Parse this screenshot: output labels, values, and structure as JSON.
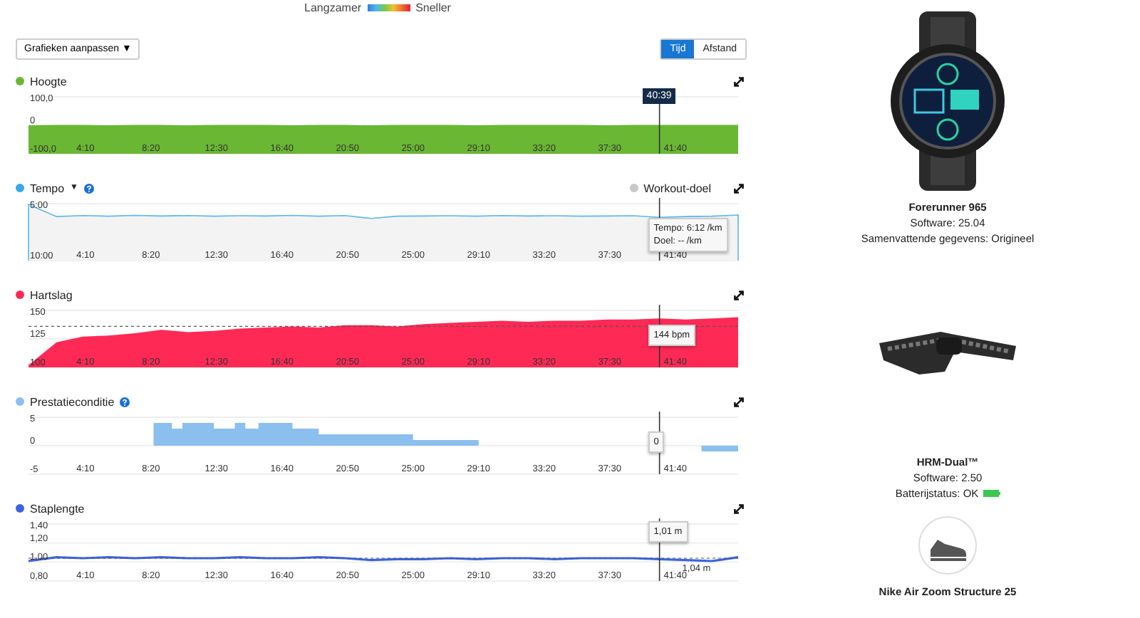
{
  "speed_legend": {
    "slow_label": "Langzamer",
    "fast_label": "Sneller"
  },
  "customize_button": {
    "label": "Grafieken aanpassen",
    "caret": "▼"
  },
  "axis_toggle": [
    {
      "label": "Tijd",
      "selected": true
    },
    {
      "label": "Afstand",
      "selected": false
    }
  ],
  "charts": [
    {
      "title": "Hoogte",
      "color": "#6ab734",
      "kind": "solid",
      "cursor_label": "40:39",
      "chart_data": {
        "type": "area",
        "xlim": [
          33,
          2740
        ],
        "ylim": [
          -100,
          100
        ],
        "yticks": [
          {
            "value": 100,
            "label": "100,0"
          },
          {
            "value": 0,
            "label": "0"
          },
          {
            "value": -100,
            "label": "-100,0"
          }
        ],
        "xticks": [
          {
            "value": 250,
            "label": "4:10"
          },
          {
            "value": 500,
            "label": "8:20"
          },
          {
            "value": 750,
            "label": "12:30"
          },
          {
            "value": 1000,
            "label": "16:40"
          },
          {
            "value": 1250,
            "label": "20:50"
          },
          {
            "value": 1500,
            "label": "25:00"
          },
          {
            "value": 1750,
            "label": "29:10"
          },
          {
            "value": 2000,
            "label": "33:20"
          },
          {
            "value": 2250,
            "label": "37:30"
          },
          {
            "value": 2500,
            "label": "41:40"
          }
        ],
        "x": [
          33,
          33,
          140,
          240,
          340,
          440,
          540,
          640,
          740,
          840,
          940,
          1040,
          1140,
          1240,
          1340,
          1440,
          1540,
          1640,
          1740,
          1840,
          1940,
          2040,
          2140,
          2240,
          2340,
          2440,
          2540,
          2640,
          2740,
          2740
        ],
        "series": [
          {
            "color": "#6ab734",
            "values": [
              -100,
              0,
              1,
              1,
              0,
              1,
              1,
              0,
              1,
              1,
              1,
              0,
              1,
              1,
              0,
              1,
              1,
              1,
              0,
              1,
              1,
              1,
              1,
              0,
              1,
              1,
              1,
              1,
              1,
              -100
            ]
          }
        ],
        "ref_lines": [
          {
            "axis": "x",
            "value": 2440
          }
        ]
      }
    },
    {
      "title": "Tempo",
      "color": "#37a9e1",
      "dropdown": "▼",
      "help": true,
      "legend": {
        "label": "Workout-doel",
        "color": "#c8c8c8"
      },
      "kind": "tint",
      "tooltip": [
        "Tempo: 6:12 /km",
        "Doel: -- /km"
      ],
      "chart_data": {
        "type": "area",
        "xlim": [
          33,
          2740
        ],
        "ylim": [
          600,
          300
        ],
        "yticks": [
          {
            "value": 300,
            "label": "5:00"
          },
          {
            "value": 600,
            "label": "10:00"
          }
        ],
        "xticks": [
          {
            "value": 250,
            "label": "4:10"
          },
          {
            "value": 500,
            "label": "8:20"
          },
          {
            "value": 750,
            "label": "12:30"
          },
          {
            "value": 1000,
            "label": "16:40"
          },
          {
            "value": 1250,
            "label": "20:50"
          },
          {
            "value": 1500,
            "label": "25:00"
          },
          {
            "value": 1750,
            "label": "29:10"
          },
          {
            "value": 2000,
            "label": "33:20"
          },
          {
            "value": 2250,
            "label": "37:30"
          },
          {
            "value": 2500,
            "label": "41:40"
          }
        ],
        "x": [
          33,
          33,
          140,
          240,
          340,
          440,
          540,
          640,
          740,
          840,
          940,
          1040,
          1140,
          1240,
          1340,
          1440,
          1540,
          1640,
          1740,
          1840,
          1940,
          2040,
          2140,
          2240,
          2340,
          2440,
          2540,
          2640,
          2740,
          2740
        ],
        "series": [
          {
            "color": "#5bb8e6",
            "values": [
              600,
              305,
              368,
              363,
              366,
              362,
              365,
              363,
              366,
              364,
              365,
              362,
              366,
              363,
              378,
              366,
              365,
              364,
              366,
              363,
              365,
              364,
              366,
              365,
              364,
              372,
              368,
              366,
              360,
              600
            ]
          }
        ],
        "ref_lines": [
          {
            "axis": "x",
            "value": 2440
          }
        ]
      }
    },
    {
      "title": "Hartslag",
      "color": "#fe2a55",
      "kind": "solid",
      "tooltip": [
        "144 bpm"
      ],
      "chart_data": {
        "type": "area",
        "xlim": [
          33,
          2740
        ],
        "ylim": [
          100,
          150
        ],
        "yticks": [
          {
            "value": 150,
            "label": "150"
          },
          {
            "value": 125,
            "label": "125"
          },
          {
            "value": 100,
            "label": "100"
          }
        ],
        "xticks": [
          {
            "value": 250,
            "label": "4:10"
          },
          {
            "value": 500,
            "label": "8:20"
          },
          {
            "value": 750,
            "label": "12:30"
          },
          {
            "value": 1000,
            "label": "16:40"
          },
          {
            "value": 1250,
            "label": "20:50"
          },
          {
            "value": 1500,
            "label": "25:00"
          },
          {
            "value": 1750,
            "label": "29:10"
          },
          {
            "value": 2000,
            "label": "33:20"
          },
          {
            "value": 2250,
            "label": "37:30"
          },
          {
            "value": 2500,
            "label": "41:40"
          }
        ],
        "x": [
          33,
          140,
          240,
          340,
          440,
          540,
          640,
          740,
          840,
          940,
          1040,
          1140,
          1240,
          1340,
          1440,
          1540,
          1640,
          1740,
          1840,
          1940,
          2040,
          2140,
          2240,
          2340,
          2440,
          2540,
          2640,
          2740
        ],
        "series": [
          {
            "color": "#fe2a55",
            "values": [
              102,
              122,
              127,
              128,
              130,
              133,
              131,
              132,
              134,
              135,
              136,
              135,
              137,
              137,
              136,
              138,
              139,
              140,
              141,
              140,
              141,
              141,
              142,
              142,
              143,
              142,
              143,
              144
            ]
          }
        ],
        "ref_lines": [
          {
            "axis": "x",
            "value": 2440
          },
          {
            "axis": "y",
            "value": 136
          }
        ]
      }
    },
    {
      "title": "Prestatieconditie",
      "color": "#8bbfee",
      "help": true,
      "kind": "step",
      "tooltip": [
        "0"
      ],
      "chart_data": {
        "type": "area",
        "xlim": [
          33,
          2740
        ],
        "ylim": [
          -5,
          5
        ],
        "yticks": [
          {
            "value": 5,
            "label": "5"
          },
          {
            "value": 0,
            "label": "0"
          },
          {
            "value": -5,
            "label": "-5"
          }
        ],
        "xticks": [
          {
            "value": 250,
            "label": "4:10"
          },
          {
            "value": 500,
            "label": "8:20"
          },
          {
            "value": 750,
            "label": "12:30"
          },
          {
            "value": 1000,
            "label": "16:40"
          },
          {
            "value": 1250,
            "label": "20:50"
          },
          {
            "value": 1500,
            "label": "25:00"
          },
          {
            "value": 1750,
            "label": "29:10"
          },
          {
            "value": 2000,
            "label": "33:20"
          },
          {
            "value": 2250,
            "label": "37:30"
          },
          {
            "value": 2500,
            "label": "41:40"
          }
        ],
        "x": [
          510,
          580,
          620,
          740,
          820,
          860,
          910,
          1040,
          1140,
          1240,
          1340,
          1440,
          1500,
          1540,
          1640,
          1750,
          1840,
          1940,
          2040,
          2140,
          2240,
          2340,
          2440,
          2540,
          2600,
          2740
        ],
        "series": [
          {
            "color": "#8bbfee",
            "values": [
              4,
              3,
              4,
              3,
              4,
              3,
              4,
              3,
              2,
              2,
              2,
              2,
              1,
              1,
              1,
              0,
              0,
              0,
              0,
              0,
              0,
              0,
              0,
              0,
              -1,
              -1
            ]
          }
        ],
        "ref_lines": [
          {
            "axis": "x",
            "value": 2440
          }
        ]
      }
    },
    {
      "title": "Staplengte",
      "color": "#3c64e0",
      "kind": "line",
      "tooltip": [
        "1,01 m"
      ],
      "chart_data": {
        "type": "line",
        "xlim": [
          33,
          2740
        ],
        "ylim": [
          0.8,
          1.4
        ],
        "yticks": [
          {
            "value": 1.4,
            "label": "1,40"
          },
          {
            "value": 1.2,
            "label": "1,20"
          },
          {
            "value": 1.0,
            "label": "1,00"
          },
          {
            "value": 0.8,
            "label": "0,80"
          }
        ],
        "xticks": [
          {
            "value": 250,
            "label": "4:10"
          },
          {
            "value": 500,
            "label": "8:20"
          },
          {
            "value": 750,
            "label": "12:30"
          },
          {
            "value": 1000,
            "label": "16:40"
          },
          {
            "value": 1250,
            "label": "20:50"
          },
          {
            "value": 1500,
            "label": "25:00"
          },
          {
            "value": 1750,
            "label": "29:10"
          },
          {
            "value": 2000,
            "label": "33:20"
          },
          {
            "value": 2250,
            "label": "37:30"
          },
          {
            "value": 2500,
            "label": "41:40"
          }
        ],
        "x": [
          33,
          140,
          240,
          340,
          440,
          540,
          640,
          740,
          840,
          940,
          1040,
          1140,
          1240,
          1340,
          1440,
          1540,
          1640,
          1740,
          1840,
          1940,
          2040,
          2140,
          2240,
          2340,
          2440,
          2540,
          2640,
          2740
        ],
        "series": [
          {
            "color": "#3c64e0",
            "values": [
              1.01,
              1.05,
              1.04,
              1.05,
              1.04,
              1.05,
              1.04,
              1.04,
              1.05,
              1.04,
              1.04,
              1.05,
              1.04,
              1.02,
              1.03,
              1.03,
              1.04,
              1.03,
              1.04,
              1.04,
              1.03,
              1.04,
              1.04,
              1.04,
              1.03,
              1.02,
              1.01,
              1.05
            ]
          }
        ],
        "ref_lines": [
          {
            "axis": "x",
            "value": 2440
          },
          {
            "axis": "y",
            "value": 1.04,
            "label": "1,04 m"
          }
        ]
      }
    }
  ],
  "devices": [
    {
      "kind": "watch",
      "name": "Forerunner 965",
      "lines": [
        {
          "text": "Software: 25.04",
          "kind": "text"
        },
        {
          "text": "Samenvattende gegevens: Origineel",
          "kind": "text"
        }
      ]
    },
    {
      "kind": "strap",
      "name": "HRM-Dual™",
      "lines": [
        {
          "text": "Software: 2.50",
          "kind": "text"
        },
        {
          "text": "Batterijstatus: OK",
          "kind": "battery"
        }
      ]
    },
    {
      "kind": "shoe",
      "name": "Nike Air Zoom Structure 25"
    }
  ]
}
